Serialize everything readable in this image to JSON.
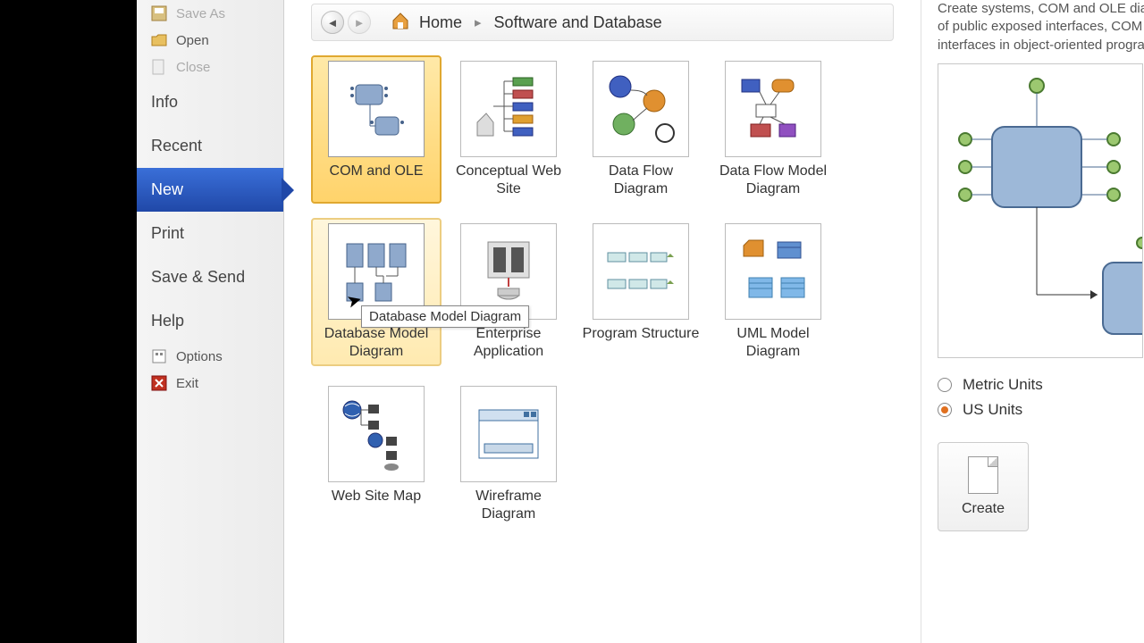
{
  "sidebar": {
    "items": [
      {
        "label": "Save As",
        "icon": "save-as-icon"
      },
      {
        "label": "Open",
        "icon": "folder-open-icon"
      },
      {
        "label": "Close",
        "icon": "close-file-icon"
      },
      {
        "label": "Info"
      },
      {
        "label": "Recent"
      },
      {
        "label": "New"
      },
      {
        "label": "Print"
      },
      {
        "label": "Save & Send"
      },
      {
        "label": "Help"
      },
      {
        "label": "Options",
        "icon": "options-icon"
      },
      {
        "label": "Exit",
        "icon": "exit-icon"
      }
    ]
  },
  "breadcrumb": {
    "home": "Home",
    "current": "Software and Database"
  },
  "templates": [
    {
      "label": "COM and OLE"
    },
    {
      "label": "Conceptual Web Site"
    },
    {
      "label": "Data Flow Diagram"
    },
    {
      "label": "Data Flow Model Diagram"
    },
    {
      "label": "Database Model Diagram"
    },
    {
      "label": "Enterprise Application"
    },
    {
      "label": "Program Structure"
    },
    {
      "label": "UML Model Diagram"
    },
    {
      "label": "Web Site Map"
    },
    {
      "label": "Wireframe Diagram"
    }
  ],
  "tooltip": "Database Model Diagram",
  "right": {
    "desc1": "Create systems, COM and OLE diag",
    "desc2": "of public exposed interfaces, COM",
    "desc3": "interfaces in object-oriented progra",
    "units": [
      {
        "label": "Metric Units",
        "checked": false
      },
      {
        "label": "US Units",
        "checked": true
      }
    ],
    "create": "Create"
  }
}
